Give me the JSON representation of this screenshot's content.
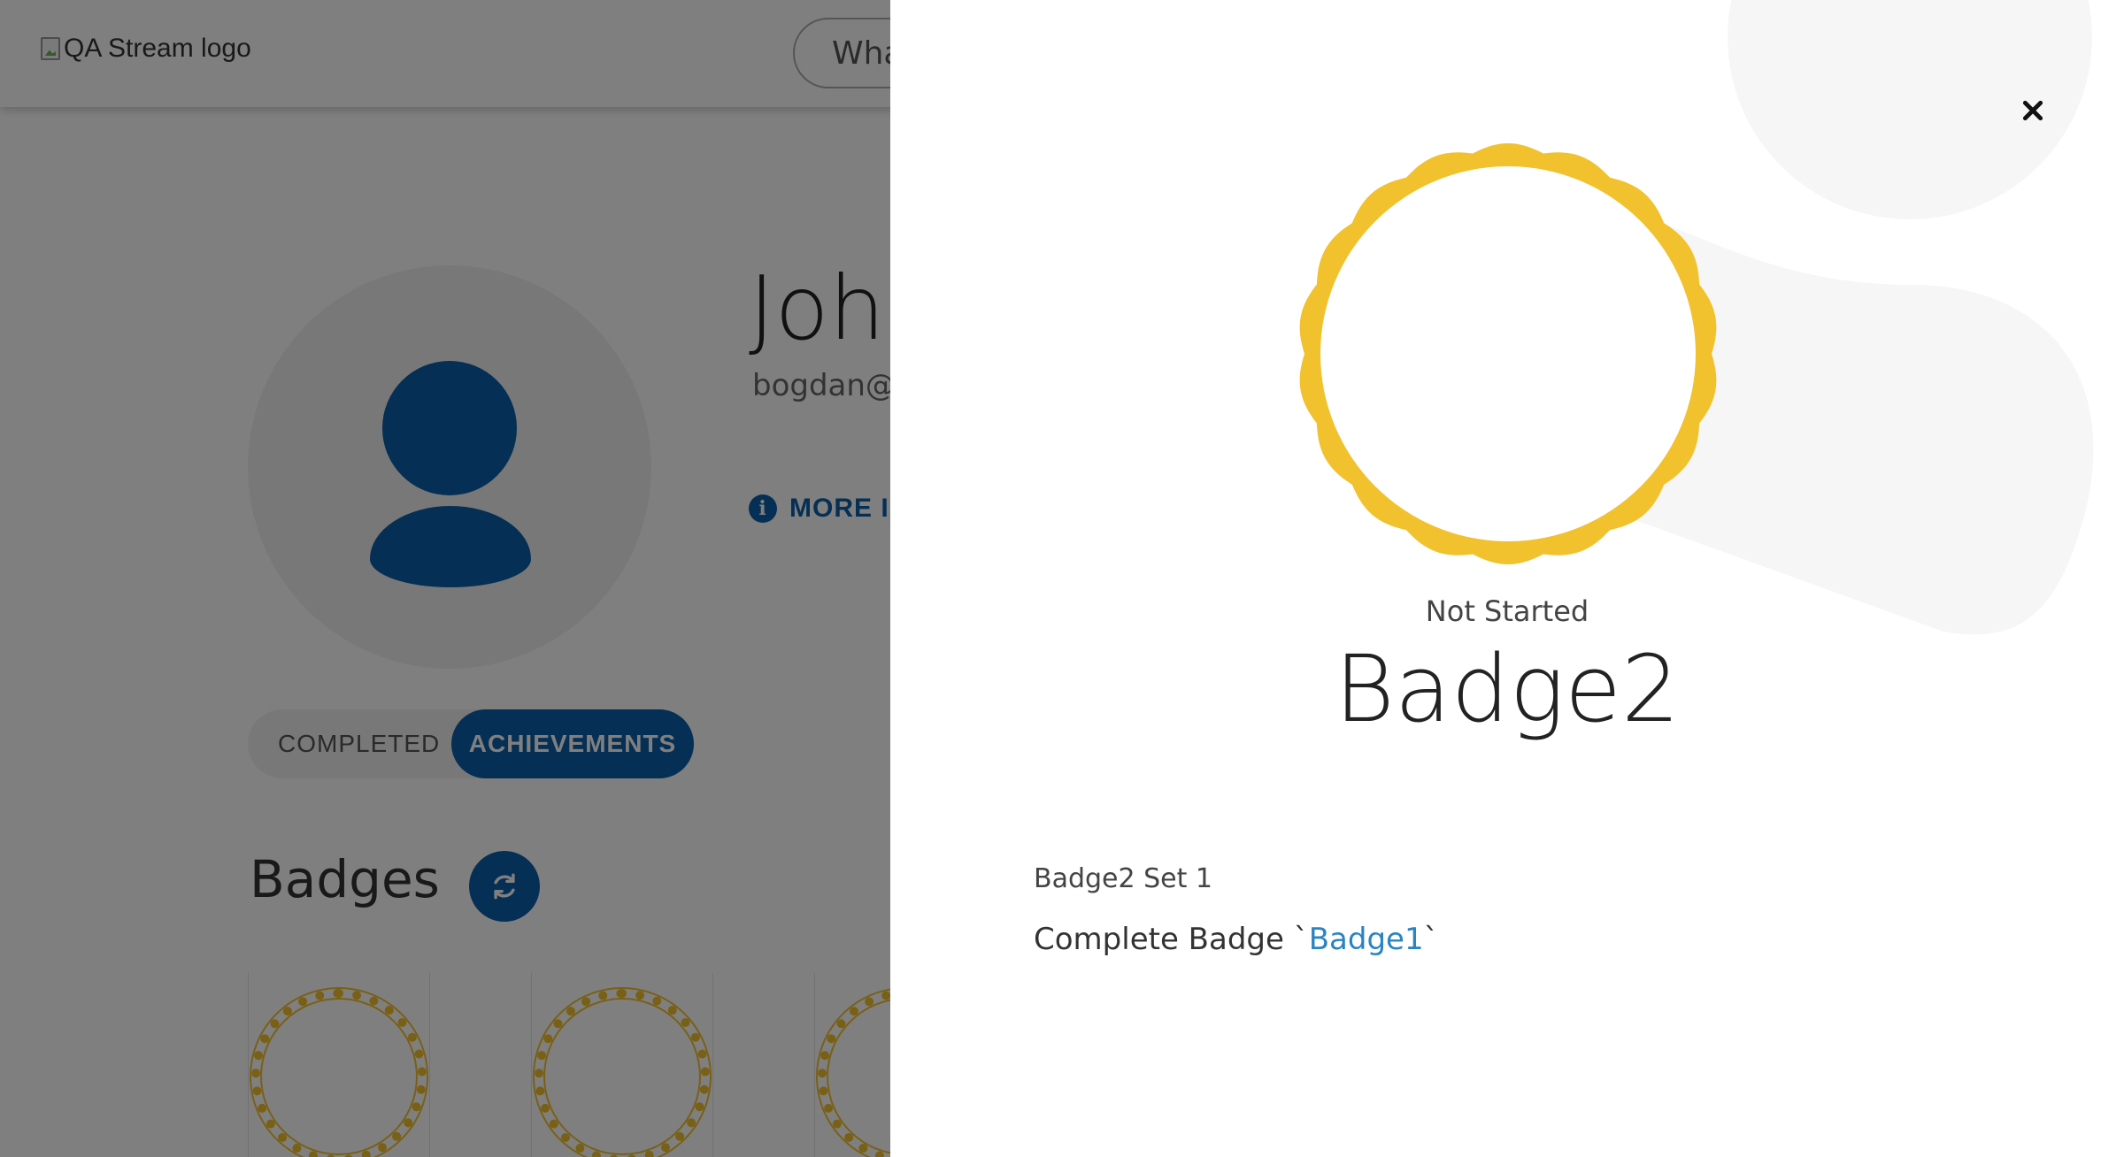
{
  "header": {
    "logo_alt": "QA Stream logo",
    "search_placeholder_visible": "Wha"
  },
  "profile": {
    "name_visible": "Joh",
    "email_visible": "bogdan@",
    "more_info_visible": "MORE IN"
  },
  "tabs": {
    "completed": "COMPLETED",
    "achievements": "ACHIEVEMENTS",
    "active": "achievements"
  },
  "badges_section": {
    "title": "Badges"
  },
  "modal": {
    "status": "Not Started",
    "title": "Badge2",
    "set_label": "Badge2 Set 1",
    "requirement_prefix": "Complete Badge `",
    "requirement_link": "Badge1",
    "requirement_suffix": "`"
  },
  "colors": {
    "brand_blue": "#0b5ea8",
    "badge_gold": "#f2c12e",
    "link_blue": "#2b84c2",
    "overlay": "rgba(0,0,0,0.5)"
  },
  "icons": {
    "close": "close-icon",
    "refresh": "refresh-icon",
    "info": "info-icon",
    "avatar": "user-avatar-icon"
  }
}
